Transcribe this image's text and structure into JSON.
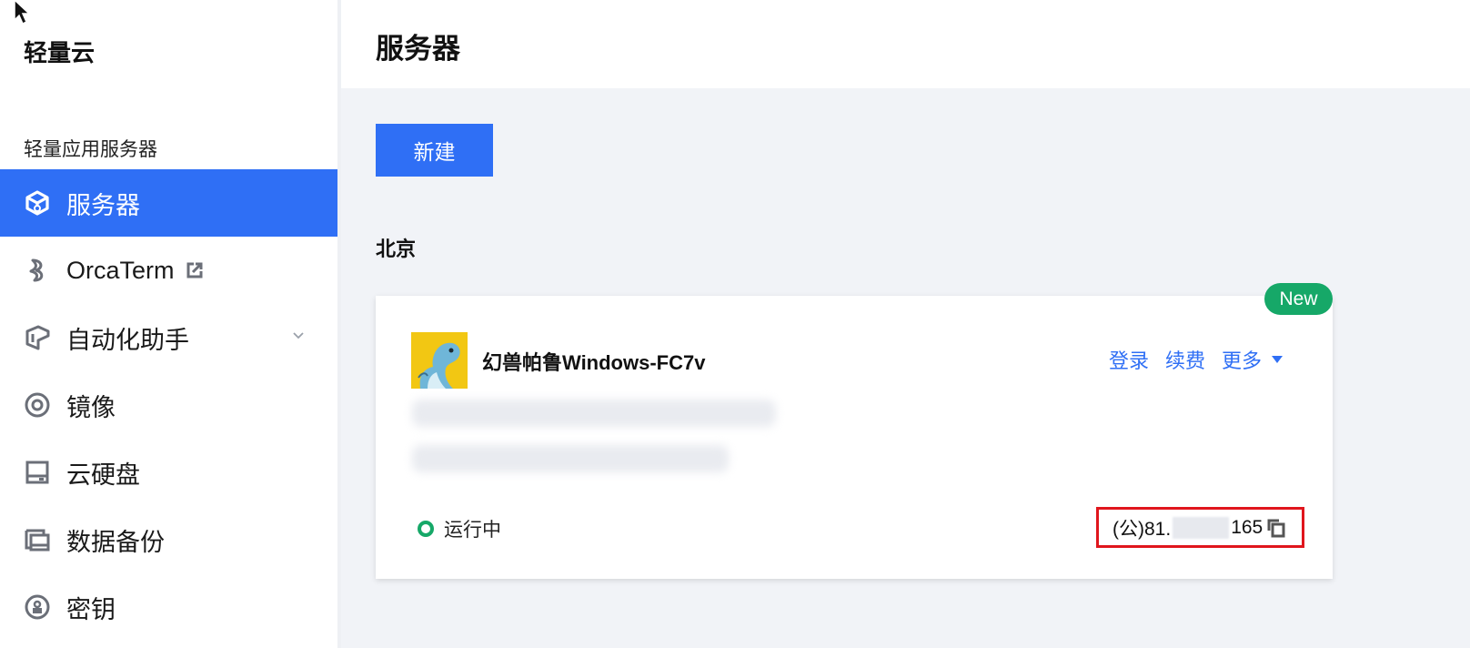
{
  "sidebar": {
    "app_title": "轻量云",
    "section_label": "轻量应用服务器",
    "items": [
      {
        "label": "服务器",
        "icon": "cube-icon",
        "active": true
      },
      {
        "label": "OrcaTerm",
        "icon": "orcaterm-icon",
        "external": true
      },
      {
        "label": "自动化助手",
        "icon": "automation-icon",
        "expandable": true
      },
      {
        "label": "镜像",
        "icon": "image-disc-icon"
      },
      {
        "label": "云硬盘",
        "icon": "disk-icon"
      },
      {
        "label": "数据备份",
        "icon": "backup-icon"
      },
      {
        "label": "密钥",
        "icon": "key-icon"
      }
    ]
  },
  "header": {
    "title": "服务器"
  },
  "main": {
    "new_button": "新建",
    "region": "北京",
    "server_card": {
      "badge": "New",
      "name": "幻兽帕鲁Windows-FC7v",
      "actions": {
        "login": "登录",
        "renew": "续费",
        "more": "更多"
      },
      "status": "运行中",
      "ip_prefix": "(公)81.",
      "ip_suffix": "165"
    }
  },
  "colors": {
    "accent": "#2f6ff5",
    "running": "#16a868",
    "highlight_border": "#e0161d"
  }
}
